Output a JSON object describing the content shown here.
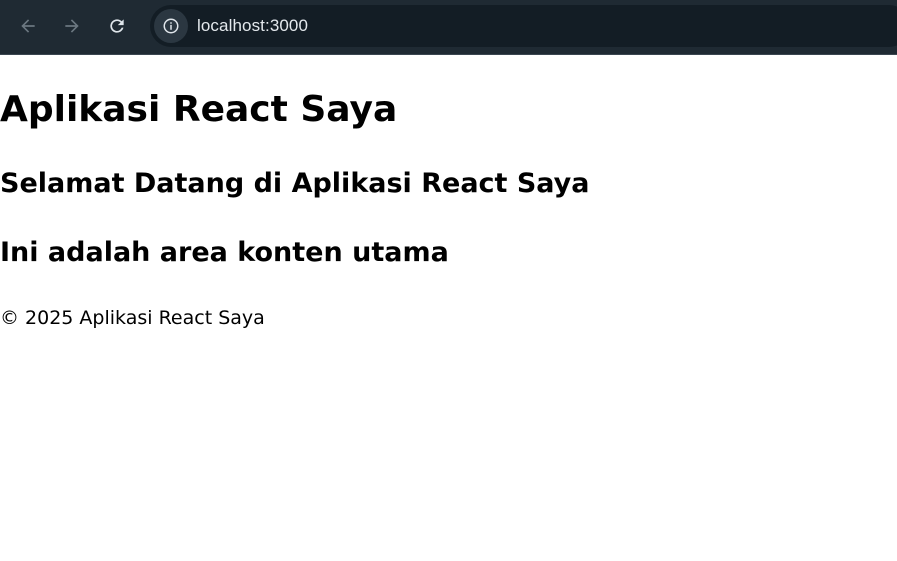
{
  "browser": {
    "url": "localhost:3000",
    "icons": {
      "back": "arrow-left-icon",
      "forward": "arrow-right-icon",
      "reload": "reload-icon",
      "site_info": "info-icon"
    },
    "colors": {
      "toolbar": "#1f2a33",
      "omnibox": "#131d25",
      "text": "#e3e8ec",
      "icon_disabled": "#6b7780",
      "icon_active": "#dfe5ea"
    }
  },
  "app": {
    "title": "Aplikasi React Saya",
    "welcome": "Selamat Datang di Aplikasi React Saya",
    "content": "Ini adalah area konten utama",
    "footer": "© 2025 Aplikasi React Saya"
  }
}
